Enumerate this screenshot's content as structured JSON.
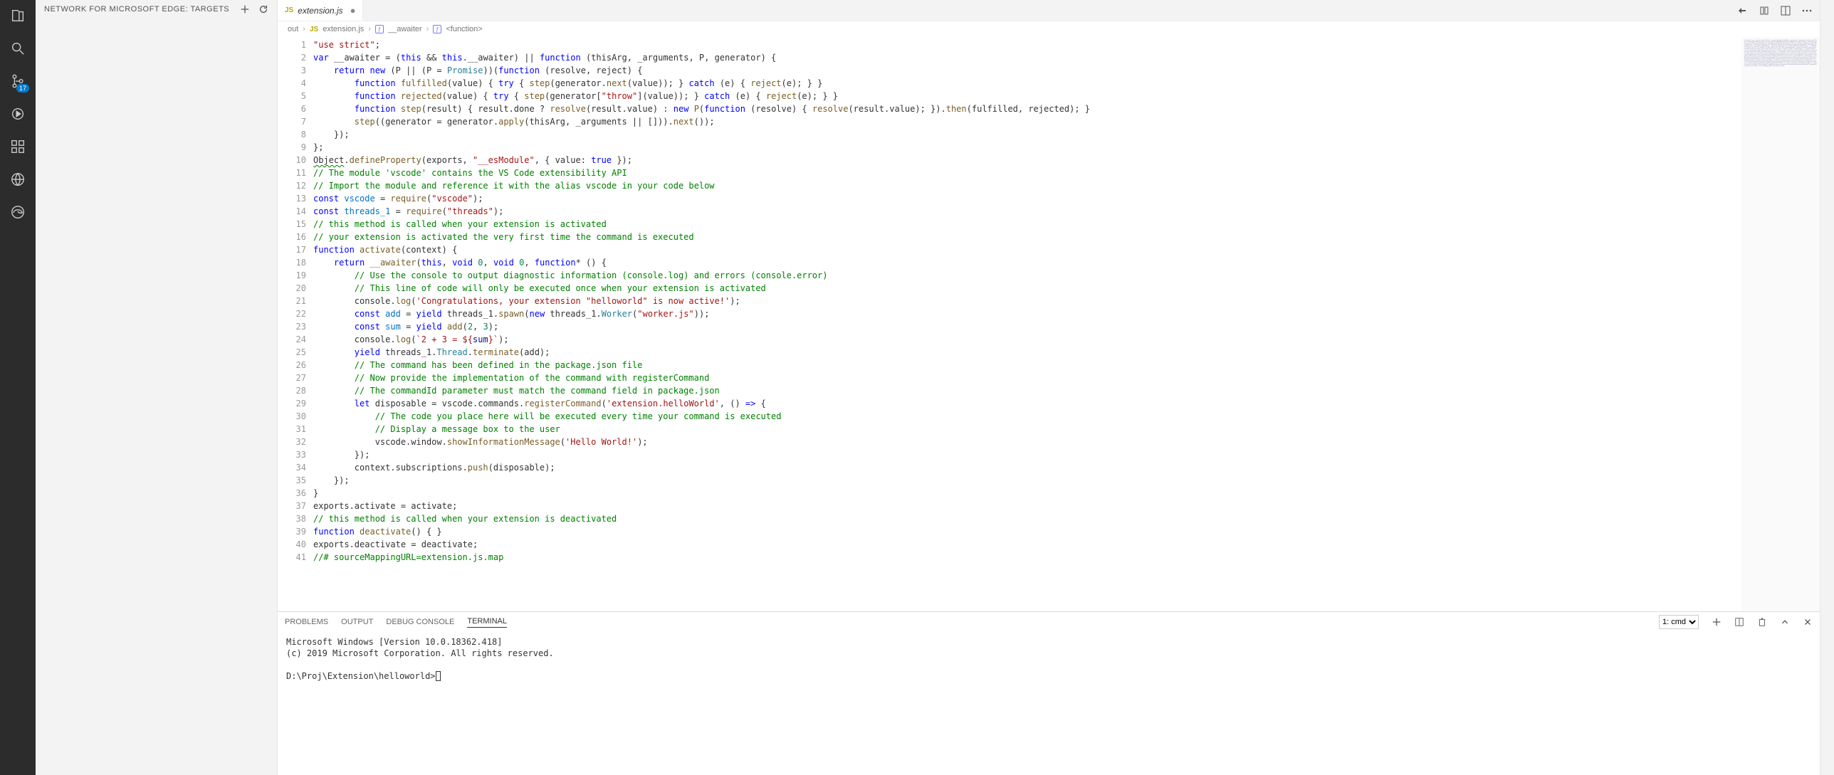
{
  "activity_bar": {
    "items": [
      {
        "name": "explorer-icon"
      },
      {
        "name": "search-icon"
      },
      {
        "name": "source-control-icon",
        "badge": "17"
      },
      {
        "name": "debug-icon"
      },
      {
        "name": "extensions-icon"
      },
      {
        "name": "remote-icon"
      },
      {
        "name": "edge-icon"
      }
    ]
  },
  "sidebar": {
    "title": "NETWORK FOR MICROSOFT EDGE: TARGETS"
  },
  "titlebar_right": {
    "icons": [
      "open-changes-icon",
      "compare-icon",
      "split-icon",
      "more-icon"
    ]
  },
  "tab": {
    "icon": "JS",
    "label": "extension.js",
    "dirty": true
  },
  "breadcrumb": {
    "items": [
      {
        "kind": "folder",
        "label": "out"
      },
      {
        "kind": "file",
        "icon": "JS",
        "label": "extension.js"
      },
      {
        "kind": "symbol",
        "icon": "⟨⟩",
        "label": "__awaiter"
      },
      {
        "kind": "symbol",
        "icon": "⟨⟩",
        "label": "<function>"
      }
    ]
  },
  "code": {
    "lines": [
      [
        {
          "t": "str",
          "v": "\"use strict\""
        },
        {
          "t": "p",
          "v": ";"
        }
      ],
      [
        {
          "t": "kw",
          "v": "var"
        },
        {
          "t": "p",
          "v": " __awaiter = ("
        },
        {
          "t": "this",
          "v": "this"
        },
        {
          "t": "p",
          "v": " && "
        },
        {
          "t": "this",
          "v": "this"
        },
        {
          "t": "p",
          "v": ".__awaiter) || "
        },
        {
          "t": "kw",
          "v": "function"
        },
        {
          "t": "p",
          "v": " (thisArg, _arguments, P, generator) {"
        }
      ],
      [
        {
          "t": "p",
          "v": "    "
        },
        {
          "t": "kw",
          "v": "return"
        },
        {
          "t": "p",
          "v": " "
        },
        {
          "t": "kw",
          "v": "new"
        },
        {
          "t": "p",
          "v": " (P || (P = "
        },
        {
          "t": "type",
          "v": "Promise"
        },
        {
          "t": "p",
          "v": "))("
        },
        {
          "t": "kw",
          "v": "function"
        },
        {
          "t": "p",
          "v": " (resolve, reject) {"
        }
      ],
      [
        {
          "t": "p",
          "v": "        "
        },
        {
          "t": "kw",
          "v": "function"
        },
        {
          "t": "p",
          "v": " "
        },
        {
          "t": "fn",
          "v": "fulfilled"
        },
        {
          "t": "p",
          "v": "(value) { "
        },
        {
          "t": "kw",
          "v": "try"
        },
        {
          "t": "p",
          "v": " { "
        },
        {
          "t": "fn",
          "v": "step"
        },
        {
          "t": "p",
          "v": "(generator."
        },
        {
          "t": "fn",
          "v": "next"
        },
        {
          "t": "p",
          "v": "(value)); } "
        },
        {
          "t": "kw",
          "v": "catch"
        },
        {
          "t": "p",
          "v": " (e) { "
        },
        {
          "t": "fn",
          "v": "reject"
        },
        {
          "t": "p",
          "v": "(e); } }"
        }
      ],
      [
        {
          "t": "p",
          "v": "        "
        },
        {
          "t": "kw",
          "v": "function"
        },
        {
          "t": "p",
          "v": " "
        },
        {
          "t": "fn",
          "v": "rejected"
        },
        {
          "t": "p",
          "v": "(value) { "
        },
        {
          "t": "kw",
          "v": "try"
        },
        {
          "t": "p",
          "v": " { "
        },
        {
          "t": "fn",
          "v": "step"
        },
        {
          "t": "p",
          "v": "(generator["
        },
        {
          "t": "str",
          "v": "\"throw\""
        },
        {
          "t": "p",
          "v": "](value)); } "
        },
        {
          "t": "kw",
          "v": "catch"
        },
        {
          "t": "p",
          "v": " (e) { "
        },
        {
          "t": "fn",
          "v": "reject"
        },
        {
          "t": "p",
          "v": "(e); } }"
        }
      ],
      [
        {
          "t": "p",
          "v": "        "
        },
        {
          "t": "kw",
          "v": "function"
        },
        {
          "t": "p",
          "v": " "
        },
        {
          "t": "fn",
          "v": "step"
        },
        {
          "t": "p",
          "v": "(result) { result.done ? "
        },
        {
          "t": "fn",
          "v": "resolve"
        },
        {
          "t": "p",
          "v": "(result.value) : "
        },
        {
          "t": "kw",
          "v": "new"
        },
        {
          "t": "p",
          "v": " "
        },
        {
          "t": "fn",
          "v": "P"
        },
        {
          "t": "p",
          "v": "("
        },
        {
          "t": "kw",
          "v": "function"
        },
        {
          "t": "p",
          "v": " (resolve) { "
        },
        {
          "t": "fn",
          "v": "resolve"
        },
        {
          "t": "p",
          "v": "(result.value); })."
        },
        {
          "t": "fn",
          "v": "then"
        },
        {
          "t": "p",
          "v": "(fulfilled, rejected); }"
        }
      ],
      [
        {
          "t": "p",
          "v": "        "
        },
        {
          "t": "fn",
          "v": "step"
        },
        {
          "t": "p",
          "v": "((generator = generator."
        },
        {
          "t": "fn",
          "v": "apply"
        },
        {
          "t": "p",
          "v": "(thisArg, _arguments || []))."
        },
        {
          "t": "fn",
          "v": "next"
        },
        {
          "t": "p",
          "v": "());"
        }
      ],
      [
        {
          "t": "p",
          "v": "    });"
        }
      ],
      [
        {
          "t": "p",
          "v": "};"
        }
      ],
      [
        {
          "t": "sq",
          "v": "Object"
        },
        {
          "t": "p",
          "v": "."
        },
        {
          "t": "fn",
          "v": "defineProperty"
        },
        {
          "t": "p",
          "v": "(exports, "
        },
        {
          "t": "str",
          "v": "\"__esModule\""
        },
        {
          "t": "p",
          "v": ", { value: "
        },
        {
          "t": "kw",
          "v": "true"
        },
        {
          "t": "p",
          "v": " });"
        }
      ],
      [
        {
          "t": "cmt",
          "v": "// The module 'vscode' contains the VS Code extensibility API"
        }
      ],
      [
        {
          "t": "cmt",
          "v": "// Import the module and reference it with the alias vscode in your code below"
        }
      ],
      [
        {
          "t": "kw",
          "v": "const"
        },
        {
          "t": "p",
          "v": " "
        },
        {
          "t": "const",
          "v": "vscode"
        },
        {
          "t": "p",
          "v": " = "
        },
        {
          "t": "fn",
          "v": "require"
        },
        {
          "t": "p",
          "v": "("
        },
        {
          "t": "str",
          "v": "\"vscode\""
        },
        {
          "t": "p",
          "v": ");"
        }
      ],
      [
        {
          "t": "kw",
          "v": "const"
        },
        {
          "t": "p",
          "v": " "
        },
        {
          "t": "const",
          "v": "threads_1"
        },
        {
          "t": "p",
          "v": " = "
        },
        {
          "t": "fn",
          "v": "require"
        },
        {
          "t": "p",
          "v": "("
        },
        {
          "t": "str",
          "v": "\"threads\""
        },
        {
          "t": "p",
          "v": ");"
        }
      ],
      [
        {
          "t": "cmt",
          "v": "// this method is called when your extension is activated"
        }
      ],
      [
        {
          "t": "cmt",
          "v": "// your extension is activated the very first time the command is executed"
        }
      ],
      [
        {
          "t": "kw",
          "v": "function"
        },
        {
          "t": "p",
          "v": " "
        },
        {
          "t": "fn",
          "v": "activate"
        },
        {
          "t": "p",
          "v": "(context) {"
        }
      ],
      [
        {
          "t": "p",
          "v": "    "
        },
        {
          "t": "kw",
          "v": "return"
        },
        {
          "t": "p",
          "v": " "
        },
        {
          "t": "fn",
          "v": "__awaiter"
        },
        {
          "t": "p",
          "v": "("
        },
        {
          "t": "this",
          "v": "this"
        },
        {
          "t": "p",
          "v": ", "
        },
        {
          "t": "kw",
          "v": "void"
        },
        {
          "t": "p",
          "v": " "
        },
        {
          "t": "num",
          "v": "0"
        },
        {
          "t": "p",
          "v": ", "
        },
        {
          "t": "kw",
          "v": "void"
        },
        {
          "t": "p",
          "v": " "
        },
        {
          "t": "num",
          "v": "0"
        },
        {
          "t": "p",
          "v": ", "
        },
        {
          "t": "kw",
          "v": "function"
        },
        {
          "t": "p",
          "v": "* () {"
        }
      ],
      [
        {
          "t": "p",
          "v": "        "
        },
        {
          "t": "cmt",
          "v": "// Use the console to output diagnostic information (console.log) and errors (console.error)"
        }
      ],
      [
        {
          "t": "p",
          "v": "        "
        },
        {
          "t": "cmt",
          "v": "// This line of code will only be executed once when your extension is activated"
        }
      ],
      [
        {
          "t": "p",
          "v": "        console."
        },
        {
          "t": "fn",
          "v": "log"
        },
        {
          "t": "p",
          "v": "("
        },
        {
          "t": "str",
          "v": "'Congratulations, your extension \"helloworld\" is now active!'"
        },
        {
          "t": "p",
          "v": ");"
        }
      ],
      [
        {
          "t": "p",
          "v": "        "
        },
        {
          "t": "kw",
          "v": "const"
        },
        {
          "t": "p",
          "v": " "
        },
        {
          "t": "const",
          "v": "add"
        },
        {
          "t": "p",
          "v": " = "
        },
        {
          "t": "kw",
          "v": "yield"
        },
        {
          "t": "p",
          "v": " threads_1."
        },
        {
          "t": "fn",
          "v": "spawn"
        },
        {
          "t": "p",
          "v": "("
        },
        {
          "t": "kw",
          "v": "new"
        },
        {
          "t": "p",
          "v": " threads_1."
        },
        {
          "t": "type",
          "v": "Worker"
        },
        {
          "t": "p",
          "v": "("
        },
        {
          "t": "str",
          "v": "\"worker.js\""
        },
        {
          "t": "p",
          "v": "));"
        }
      ],
      [
        {
          "t": "p",
          "v": "        "
        },
        {
          "t": "kw",
          "v": "const"
        },
        {
          "t": "p",
          "v": " "
        },
        {
          "t": "const",
          "v": "sum"
        },
        {
          "t": "p",
          "v": " = "
        },
        {
          "t": "kw",
          "v": "yield"
        },
        {
          "t": "p",
          "v": " "
        },
        {
          "t": "fn",
          "v": "add"
        },
        {
          "t": "p",
          "v": "("
        },
        {
          "t": "num",
          "v": "2"
        },
        {
          "t": "p",
          "v": ", "
        },
        {
          "t": "num",
          "v": "3"
        },
        {
          "t": "p",
          "v": ");"
        }
      ],
      [
        {
          "t": "p",
          "v": "        console."
        },
        {
          "t": "fn",
          "v": "log"
        },
        {
          "t": "p",
          "v": "("
        },
        {
          "t": "str",
          "v": "`2 + 3 = ${"
        },
        {
          "t": "var",
          "v": "sum"
        },
        {
          "t": "str",
          "v": "}`"
        },
        {
          "t": "p",
          "v": ");"
        }
      ],
      [
        {
          "t": "p",
          "v": "        "
        },
        {
          "t": "kw",
          "v": "yield"
        },
        {
          "t": "p",
          "v": " threads_1."
        },
        {
          "t": "type",
          "v": "Thread"
        },
        {
          "t": "p",
          "v": "."
        },
        {
          "t": "fn",
          "v": "terminate"
        },
        {
          "t": "p",
          "v": "(add);"
        }
      ],
      [
        {
          "t": "p",
          "v": "        "
        },
        {
          "t": "cmt",
          "v": "// The command has been defined in the package.json file"
        }
      ],
      [
        {
          "t": "p",
          "v": "        "
        },
        {
          "t": "cmt",
          "v": "// Now provide the implementation of the command with registerCommand"
        }
      ],
      [
        {
          "t": "p",
          "v": "        "
        },
        {
          "t": "cmt",
          "v": "// The commandId parameter must match the command field in package.json"
        }
      ],
      [
        {
          "t": "p",
          "v": "        "
        },
        {
          "t": "kw",
          "v": "let"
        },
        {
          "t": "p",
          "v": " disposable = vscode.commands."
        },
        {
          "t": "fn",
          "v": "registerCommand"
        },
        {
          "t": "p",
          "v": "("
        },
        {
          "t": "str",
          "v": "'extension.helloWorld'"
        },
        {
          "t": "p",
          "v": ", () "
        },
        {
          "t": "kw",
          "v": "=>"
        },
        {
          "t": "p",
          "v": " {"
        }
      ],
      [
        {
          "t": "p",
          "v": "            "
        },
        {
          "t": "cmt",
          "v": "// The code you place here will be executed every time your command is executed"
        }
      ],
      [
        {
          "t": "p",
          "v": "            "
        },
        {
          "t": "cmt",
          "v": "// Display a message box to the user"
        }
      ],
      [
        {
          "t": "p",
          "v": "            vscode.window."
        },
        {
          "t": "fn",
          "v": "showInformationMessage"
        },
        {
          "t": "p",
          "v": "("
        },
        {
          "t": "str",
          "v": "'Hello World!'"
        },
        {
          "t": "p",
          "v": ");"
        }
      ],
      [
        {
          "t": "p",
          "v": "        });"
        }
      ],
      [
        {
          "t": "p",
          "v": "        context.subscriptions."
        },
        {
          "t": "fn",
          "v": "push"
        },
        {
          "t": "p",
          "v": "(disposable);"
        }
      ],
      [
        {
          "t": "p",
          "v": "    });"
        }
      ],
      [
        {
          "t": "p",
          "v": "}"
        }
      ],
      [
        {
          "t": "p",
          "v": "exports.activate = activate;"
        }
      ],
      [
        {
          "t": "cmt",
          "v": "// this method is called when your extension is deactivated"
        }
      ],
      [
        {
          "t": "kw",
          "v": "function"
        },
        {
          "t": "p",
          "v": " "
        },
        {
          "t": "fn",
          "v": "deactivate"
        },
        {
          "t": "p",
          "v": "() { }"
        }
      ],
      [
        {
          "t": "p",
          "v": "exports.deactivate = deactivate;"
        }
      ],
      [
        {
          "t": "cmt",
          "v": "//# sourceMappingURL=extension.js.map"
        }
      ]
    ]
  },
  "panel": {
    "tabs": [
      "PROBLEMS",
      "OUTPUT",
      "DEBUG CONSOLE",
      "TERMINAL"
    ],
    "active": 3,
    "terminal_selector": "1: cmd",
    "terminal_lines": [
      "Microsoft Windows [Version 10.0.18362.418]",
      "(c) 2019 Microsoft Corporation. All rights reserved.",
      "",
      "D:\\Proj\\Extension\\helloworld>"
    ]
  }
}
